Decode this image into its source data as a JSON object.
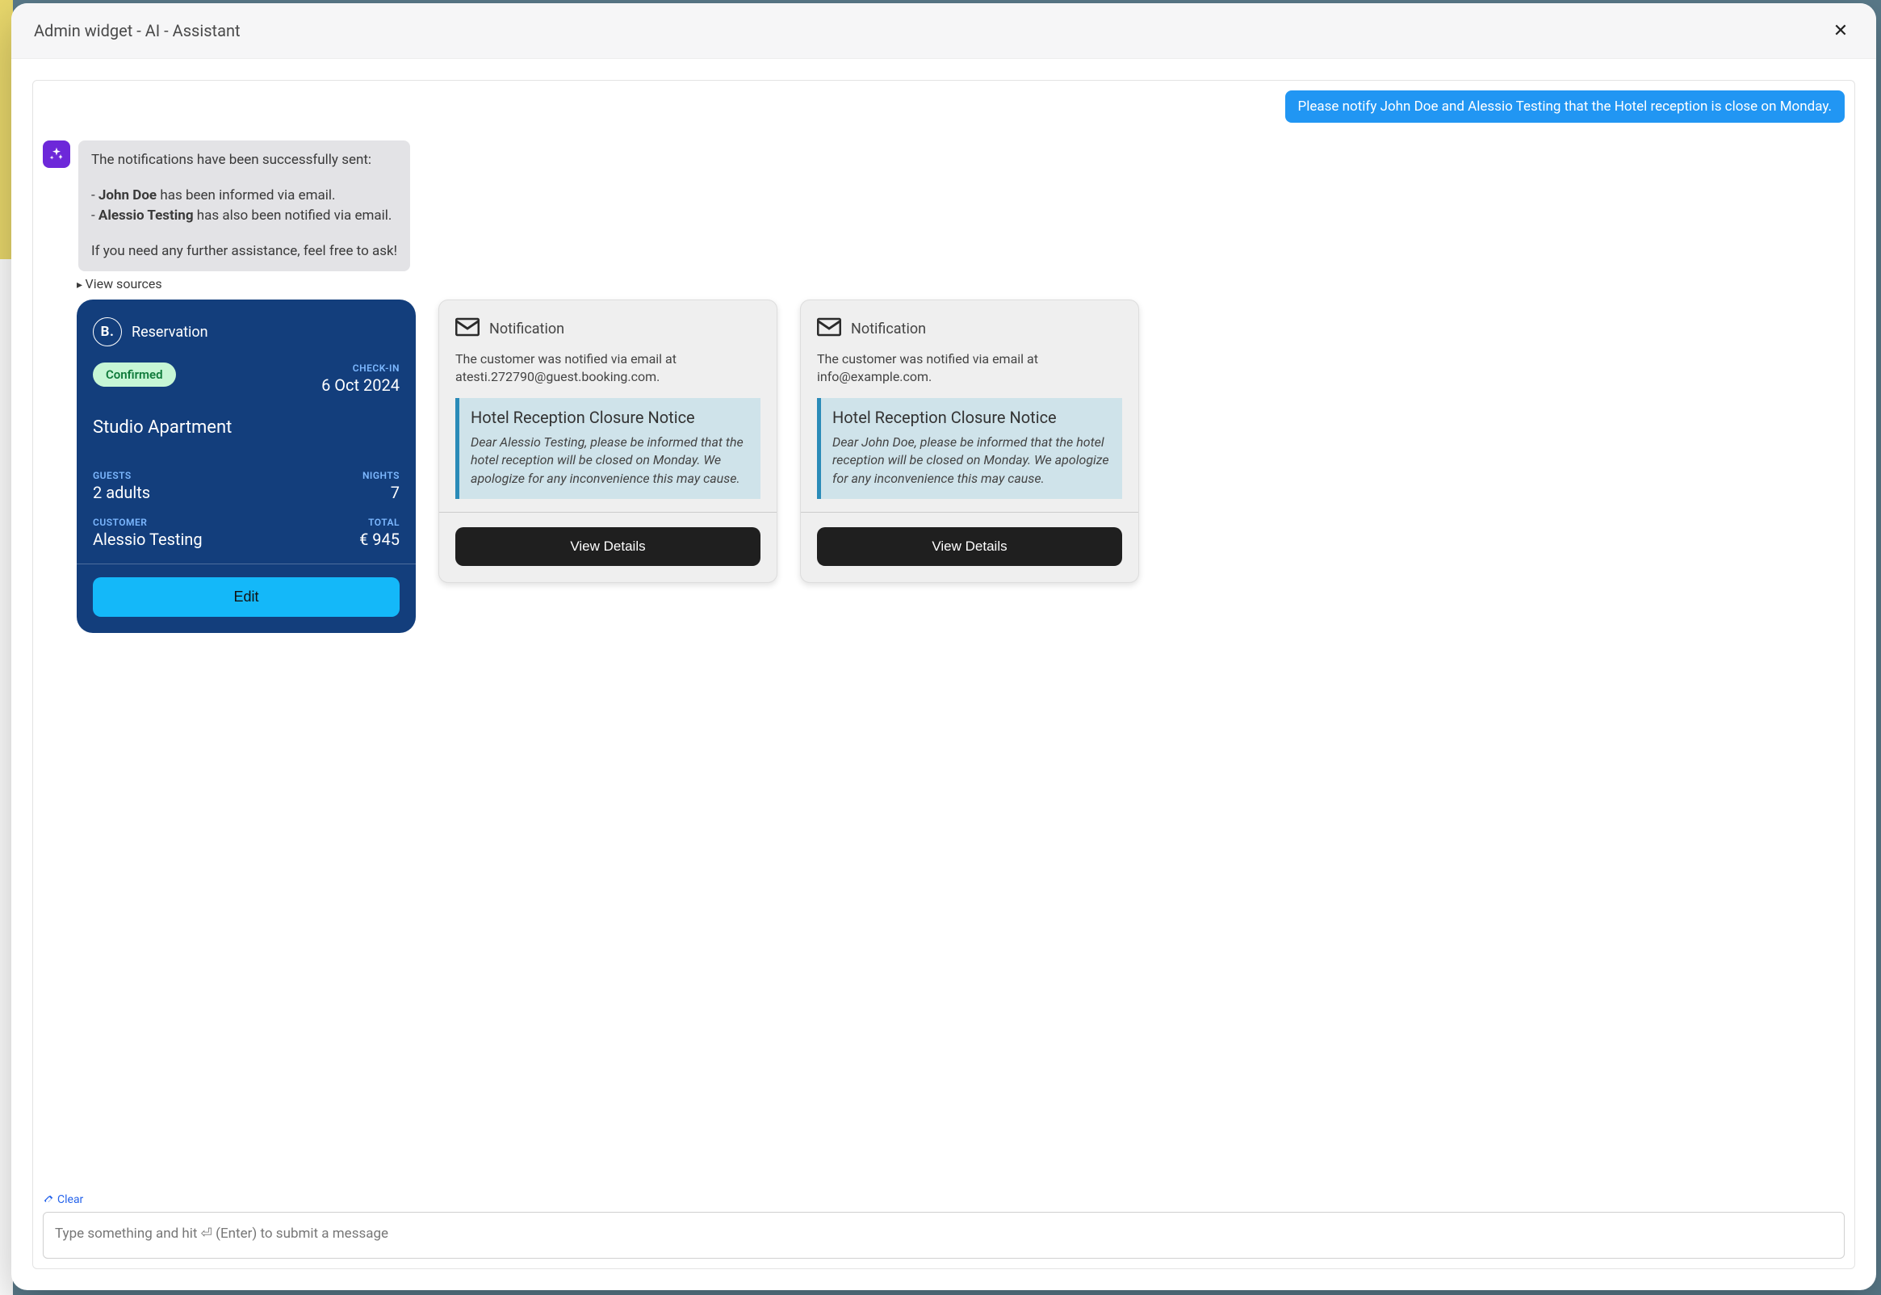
{
  "modal": {
    "title": "Admin widget - AI - Assistant"
  },
  "chat": {
    "user_message": "Please notify John Doe and Alessio Testing that the Hotel reception is close on Monday.",
    "assistant": {
      "intro": "The notifications have been successfully sent:",
      "line1_prefix": "- ",
      "line1_bold": "John Doe",
      "line1_rest": " has been informed via email.",
      "line2_prefix": "- ",
      "line2_bold": "Alessio Testing",
      "line2_rest": " has also been notified via email.",
      "outro": "If you need any further assistance, feel free to ask!"
    },
    "view_sources_label": "View sources"
  },
  "reservation": {
    "brand_glyph": "B.",
    "title": "Reservation",
    "status": "Confirmed",
    "checkin_label": "CHECK-IN",
    "checkin_value": "6 Oct 2024",
    "unit_name": "Studio Apartment",
    "guests_label": "GUESTS",
    "guests_value": "2 adults",
    "nights_label": "NIGHTS",
    "nights_value": "7",
    "customer_label": "CUSTOMER",
    "customer_value": "Alessio Testing",
    "total_label": "TOTAL",
    "total_value": "€ 945",
    "edit_label": "Edit"
  },
  "notifications": [
    {
      "title": "Notification",
      "desc": "The customer was notified via email at atesti.272790@guest.booking.com.",
      "subject": "Hotel Reception Closure Notice",
      "body": "Dear Alessio Testing, please be informed that the hotel reception will be closed on Monday. We apologize for any inconvenience this may cause.",
      "button": "View Details"
    },
    {
      "title": "Notification",
      "desc": "The customer was notified via email at info@example.com.",
      "subject": "Hotel Reception Closure Notice",
      "body": "Dear John Doe, please be informed that the hotel reception will be closed on Monday. We apologize for any inconvenience this may cause.",
      "button": "View Details"
    }
  ],
  "footer": {
    "clear_label": "Clear",
    "input_placeholder": "Type something and hit ⏎ (Enter) to submit a message"
  }
}
